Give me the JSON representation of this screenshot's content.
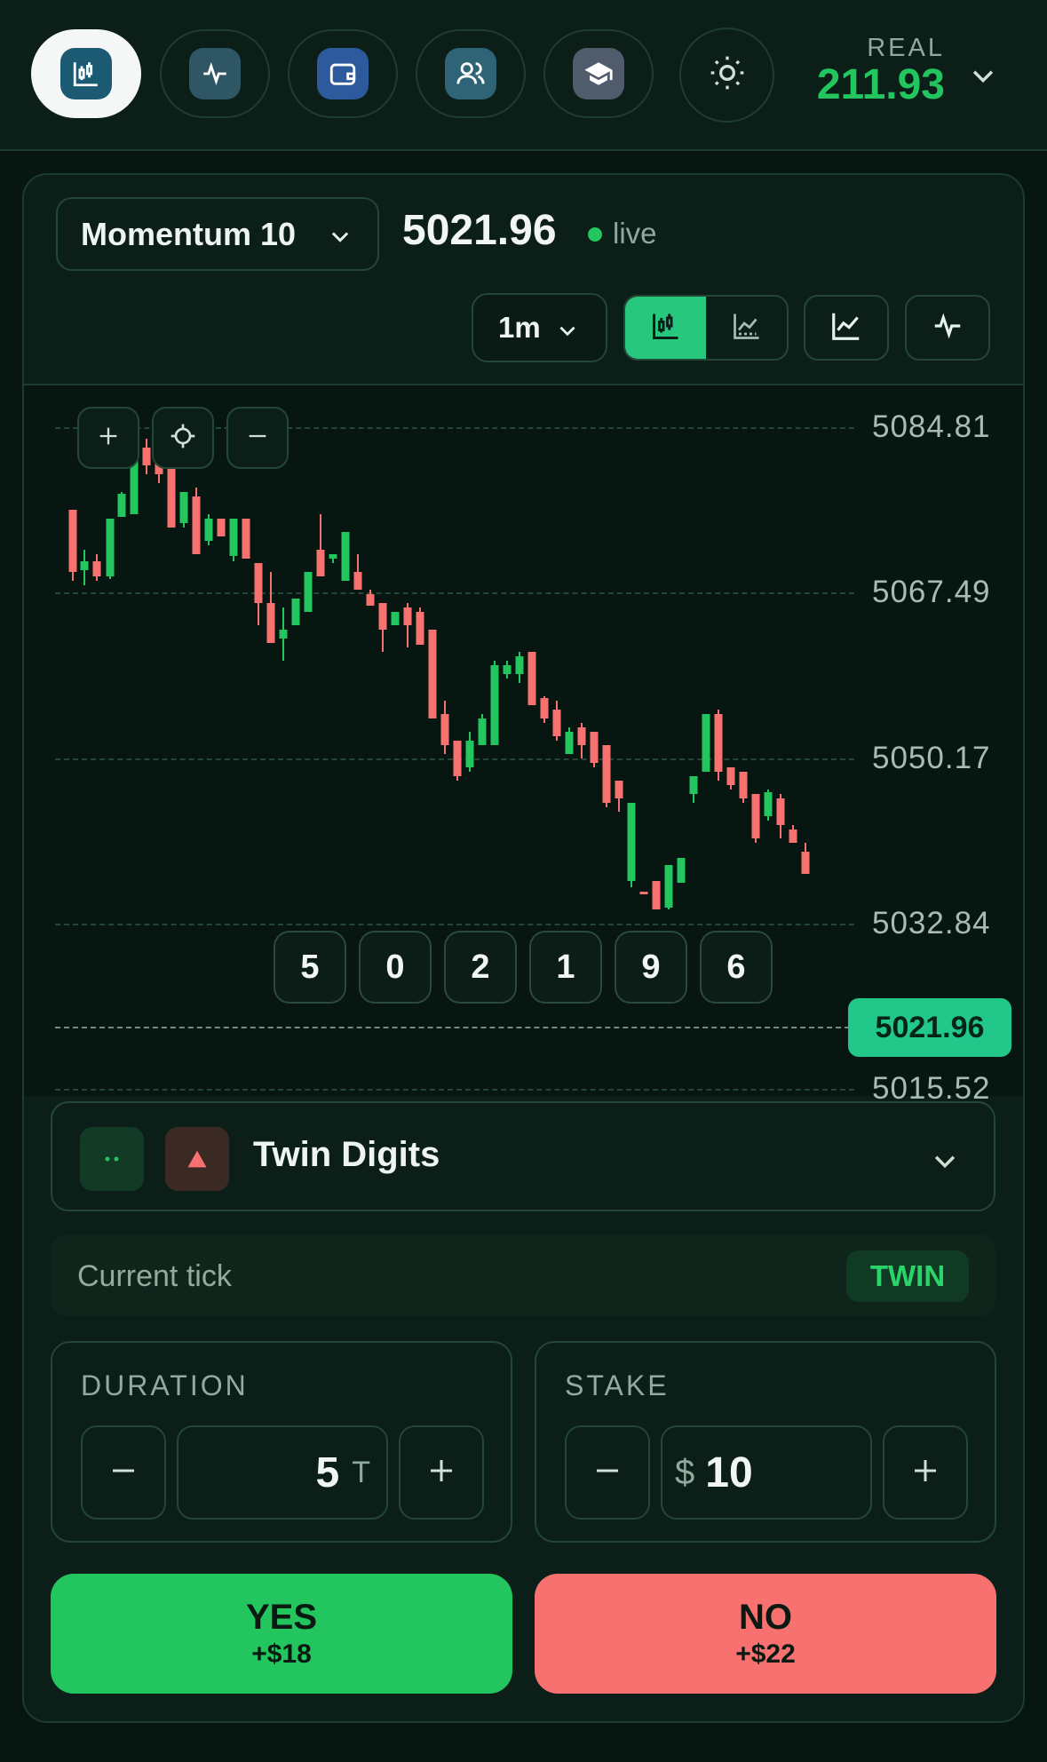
{
  "nav": {
    "items": [
      {
        "name": "chart-icon",
        "active": true
      },
      {
        "name": "pulse-icon",
        "active": false
      },
      {
        "name": "wallet-icon",
        "active": false
      },
      {
        "name": "users-icon",
        "active": false
      },
      {
        "name": "graduation-cap-icon",
        "active": false
      }
    ],
    "settings_icon": "sun-icon"
  },
  "account": {
    "type": "REAL",
    "balance": "211.93"
  },
  "market": {
    "symbol": "Momentum 10",
    "price": "5021.96",
    "status": "live"
  },
  "chart_controls": {
    "timeframe": "1m",
    "modes": [
      "candlestick-icon",
      "area-chart-icon"
    ],
    "active_mode": "candlestick-icon",
    "extra": [
      "line-chart-icon",
      "pulse-icon"
    ],
    "zoom": [
      "+",
      "crosshair-icon",
      "−"
    ]
  },
  "chart": {
    "y_labels": [
      "5084.81",
      "5067.49",
      "5050.17",
      "5032.84",
      "5015.52"
    ],
    "current_price": "5021.96",
    "last_digits": [
      "5",
      "0",
      "2",
      "1",
      "9",
      "6"
    ]
  },
  "contract": {
    "name": "Twin Digits"
  },
  "tick": {
    "label": "Current tick",
    "badge": "TWIN"
  },
  "duration": {
    "title": "DURATION",
    "value": "5",
    "unit": "T"
  },
  "stake": {
    "title": "STAKE",
    "currency": "$",
    "value": "10"
  },
  "trade": {
    "yes": {
      "label": "YES",
      "payout": "+$18"
    },
    "no": {
      "label": "NO",
      "payout": "+$22"
    }
  },
  "colors": {
    "up": "#22c55e",
    "down": "#f87171",
    "accent": "#27c77e"
  }
}
